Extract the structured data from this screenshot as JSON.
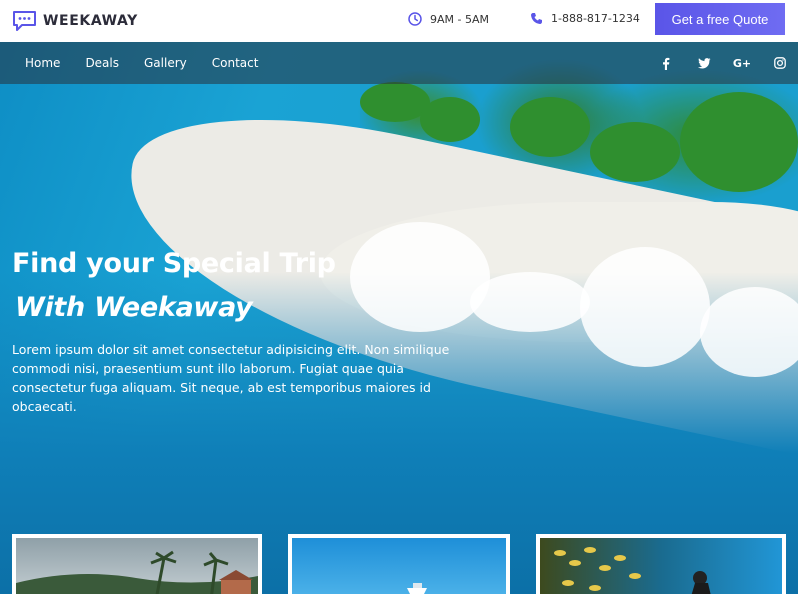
{
  "brand": {
    "name": "WEEKAWAY"
  },
  "header": {
    "hours": "9AM - 5AM",
    "phone": "1-888-817-1234",
    "quote_button": "Get a free Quote"
  },
  "nav": {
    "items": [
      {
        "label": "Home"
      },
      {
        "label": "Deals"
      },
      {
        "label": "Gallery"
      },
      {
        "label": "Contact"
      }
    ],
    "socials": [
      "facebook-icon",
      "twitter-icon",
      "google-plus-icon",
      "instagram-icon"
    ],
    "google_plus_text": "G+"
  },
  "hero": {
    "title": "Find your Special Trip",
    "subtitle": "With Weekaway",
    "description": "Lorem ipsum dolor sit amet consectetur adipisicing elit. Non similique commodi nisi, praesentium sunt illo laborum. Fugiat quae quia consectetur fuga aliquam. Sit neque, ab est temporibus maiores id obcaecati."
  },
  "colors": {
    "accent": "#5a55e8",
    "nav_overlay": "#28323c"
  }
}
